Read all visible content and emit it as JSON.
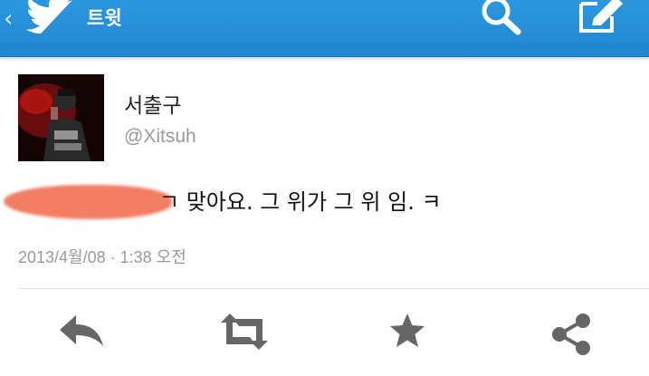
{
  "header": {
    "back_glyph": "‹",
    "title": "트윗",
    "icons": [
      "bird-icon",
      "search-icon",
      "compose-icon"
    ],
    "accent_color": "#1f86cf"
  },
  "tweet": {
    "author_name": "서출구",
    "author_handle": "@Xitsuh",
    "text_visible": "ㄱ 맞아요. 그 위가 그 위 임. ㅋ",
    "timestamp": "2013/4월/08 · 1:38 오전",
    "redaction_color": "#f47e63"
  },
  "actions": [
    "reply-icon",
    "retweet-icon",
    "favorite-icon",
    "share-icon"
  ]
}
